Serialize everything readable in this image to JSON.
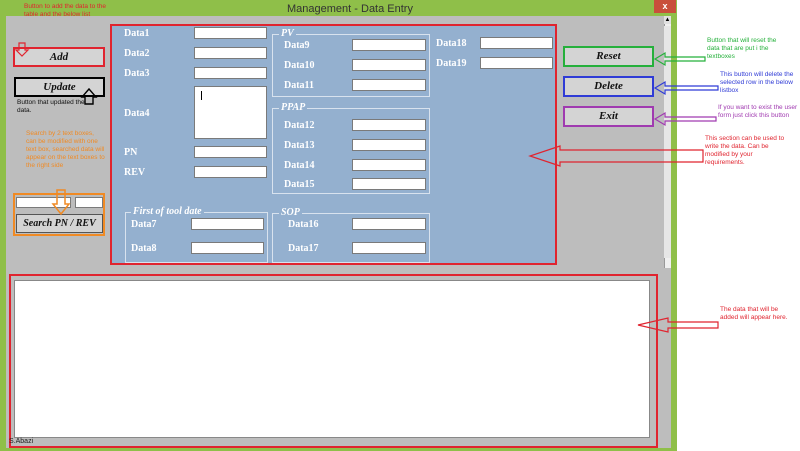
{
  "window": {
    "title": "Management - Data Entry",
    "close_label": "x"
  },
  "buttons": {
    "add": "Add",
    "update": "Update",
    "search": "Search PN / REV",
    "reset": "Reset",
    "delete": "Delete",
    "exit": "Exit"
  },
  "fields": {
    "data1": "Data1",
    "data2": "Data2",
    "data3": "Data3",
    "data4": "Data4",
    "pn": "PN",
    "rev": "REV",
    "data7": "Data7",
    "data8": "Data8",
    "data9": "Data9",
    "data10": "Data10",
    "data11": "Data11",
    "data12": "Data12",
    "data13": "Data13",
    "data14": "Data14",
    "data15": "Data15",
    "data16": "Data16",
    "data17": "Data17",
    "data18": "Data18",
    "data19": "Data19"
  },
  "groups": {
    "pv": "PV",
    "ppap": "PPAP",
    "first_tool": "First of tool date",
    "sop": "SOP"
  },
  "annotations": {
    "add": "Button to add the data to the table and the below list",
    "update": "Button that updated the data.",
    "search": "Search by 2 text boxes, can be modified with one text box, searched data will appear on the text boxes to the right side",
    "reset": "Button that will reset the data that are put i the textboxes",
    "delete": "This button will delete the selected row in the below listbox",
    "exit": "If you want to exist the user form just click this button",
    "section": "This section can be used to write the data. Can be modified by your requirements.",
    "listbox": "The data that will be added will appear here."
  },
  "footer": {
    "author": "S.Abazi"
  },
  "colors": {
    "frame": "#8fbf49",
    "panel": "#94b0cf",
    "red": "#e0242f",
    "orange": "#f08a24",
    "green": "#25b03b",
    "blue": "#2f3bd6",
    "purple": "#a03ab0"
  }
}
